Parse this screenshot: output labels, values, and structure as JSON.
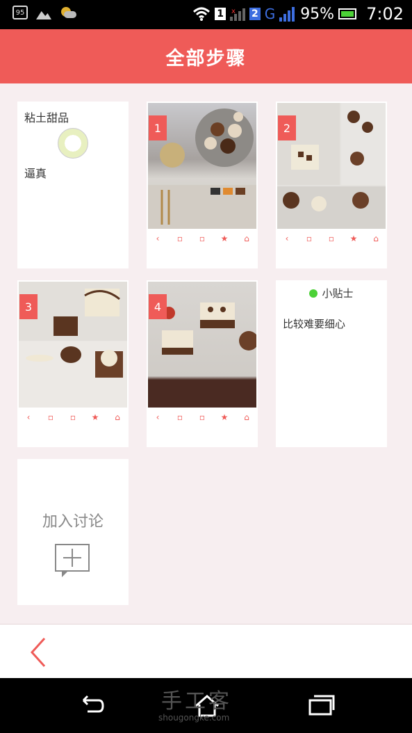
{
  "status": {
    "notif_count": "95",
    "sim1": "1",
    "sim2": "2",
    "network": "G",
    "battery_pct": "95%",
    "time": "7:02"
  },
  "header": {
    "title": "全部步骤"
  },
  "intro_card": {
    "title": "粘土甜品",
    "subtitle": "逼真"
  },
  "steps": [
    {
      "number": "1"
    },
    {
      "number": "2"
    },
    {
      "number": "3"
    },
    {
      "number": "4"
    }
  ],
  "tips": {
    "title": "小贴士",
    "body": "比较难要细心"
  },
  "join": {
    "label": "加入讨论"
  },
  "watermark": {
    "main": "手工客",
    "sub": "shougongke.com"
  },
  "colors": {
    "accent": "#ef5b58",
    "tip_dot": "#4cd137"
  }
}
